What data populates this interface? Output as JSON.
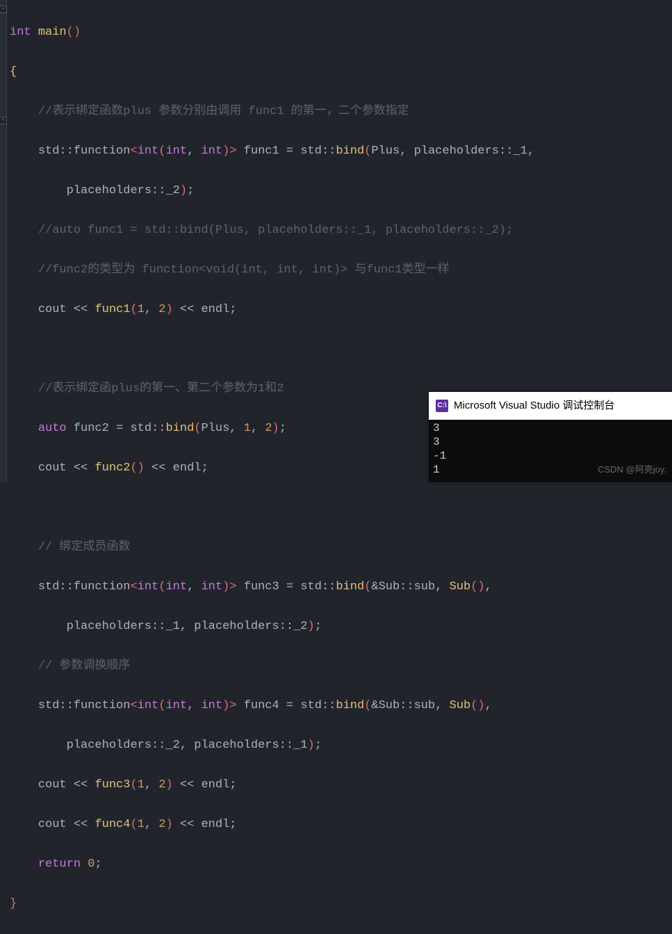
{
  "code": {
    "indent": "    ",
    "l1_kw_int": "int",
    "l1_fn_main": "main",
    "l1_paren": "()",
    "l2_brace": "{",
    "l3_c": "//表示绑定函数plus 参数分别由调用 func1 的第一，二个参数指定",
    "l4_ns": "std",
    "l4_sep": "::",
    "l4_tpl": "function",
    "l4_lt": "<",
    "l4_t1": "int",
    "l4_paren_o": "(",
    "l4_t2": "int",
    "l4_comma": ", ",
    "l4_t3": "int",
    "l4_paren_c": ")",
    "l4_gt": ">",
    "l4_sp": " ",
    "l4_var": "func1",
    "l4_eq": " = ",
    "l4_std2": "std",
    "l4_bind": "bind",
    "l4_Plus": "Plus",
    "l4_ph_ns": "placeholders",
    "l4_ph1": "_1",
    "l5_ph2": "_2",
    "l5_semi": ";",
    "l6_c": "//auto func1 = std::bind(Plus, placeholders::_1, placeholders::_2);",
    "l7_c": "//func2的类型为 function<void(int, int, int)> 与func1类型一样",
    "l8_cout": "cout",
    "l8_ins": " << ",
    "l8_fn": "func1",
    "l8_args_o": "(",
    "l8_n1": "1",
    "l8_n2": "2",
    "l8_args_c": ")",
    "l8_endl": "endl",
    "l8_semi": ";",
    "l10_c": "//表示绑定函plus的第一、第二个参数为1和2",
    "l11_auto": "auto",
    "l11_var": "func2",
    "l11_eq": " = ",
    "l11_std": "std",
    "l11_bind": "bind",
    "l11_Plus": "Plus",
    "l11_n1": "1",
    "l11_n2": "2",
    "l12_cout": "cout",
    "l12_fn": "func2",
    "l12_endl": "endl",
    "l14_c": "// 绑定成员函数",
    "l15_var": "func3",
    "l15_Sub": "Sub",
    "l15_sub": "sub",
    "l15_amp": "&",
    "l17_c": "// 参数调换顺序",
    "l18_var": "func4",
    "l20_fn": "func3",
    "l21_fn": "func4",
    "l22_kw": "return",
    "l22_n0": "0",
    "l23_brace": "}"
  },
  "console": {
    "title": "Microsoft Visual Studio 调试控制台",
    "icon_text": "C:\\",
    "out1": "3",
    "out2": "3",
    "out3": "-1",
    "out4": "1"
  },
  "watermark": "CSDN @阿亮joy."
}
